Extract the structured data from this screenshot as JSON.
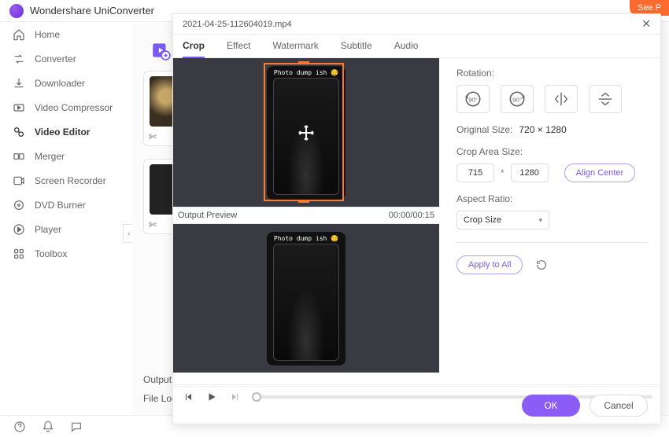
{
  "app": {
    "title": "Wondershare UniConverter",
    "see_label": "See P"
  },
  "sidebar": {
    "items": [
      {
        "label": "Home",
        "icon": "home-icon"
      },
      {
        "label": "Converter",
        "icon": "converter-icon"
      },
      {
        "label": "Downloader",
        "icon": "downloader-icon"
      },
      {
        "label": "Video Compressor",
        "icon": "compressor-icon"
      },
      {
        "label": "Video Editor",
        "icon": "editor-icon"
      },
      {
        "label": "Merger",
        "icon": "merger-icon"
      },
      {
        "label": "Screen Recorder",
        "icon": "recorder-icon"
      },
      {
        "label": "DVD Burner",
        "icon": "burner-icon"
      },
      {
        "label": "Player",
        "icon": "player-icon"
      },
      {
        "label": "Toolbox",
        "icon": "toolbox-icon"
      }
    ],
    "active_index": 4
  },
  "main": {
    "output_label": "Output F",
    "file_loc_label": "File Loca"
  },
  "dialog": {
    "title": "2021-04-25-112604019.mp4",
    "tabs": [
      {
        "label": "Crop"
      },
      {
        "label": "Effect"
      },
      {
        "label": "Watermark"
      },
      {
        "label": "Subtitle"
      },
      {
        "label": "Audio"
      }
    ],
    "active_tab": 0,
    "preview": {
      "output_label": "Output Preview",
      "time": "00:00/00:15",
      "overlay_text": "Photo dump ish 😏"
    },
    "controls": {
      "rotation_label": "Rotation:",
      "original_size_label": "Original Size:",
      "original_size_value": "720 × 1280",
      "crop_area_label": "Crop Area Size:",
      "crop_w": "715",
      "crop_h": "1280",
      "align_center_label": "Align Center",
      "aspect_label": "Aspect Ratio:",
      "aspect_value": "Crop Size",
      "apply_all_label": "Apply to All"
    },
    "footer": {
      "ok": "OK",
      "cancel": "Cancel"
    }
  }
}
